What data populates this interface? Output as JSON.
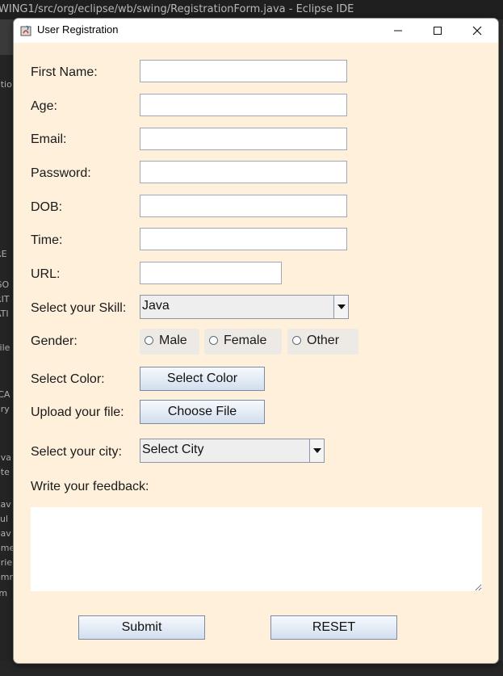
{
  "ide": {
    "title": "WING1/src/org/eclipse/wb/swing/RegistrationForm.java - Eclipse IDE",
    "left_fragments": [
      "atio",
      "RE",
      "GO",
      "RIT",
      "ATI",
      "File",
      "ICA",
      "ary",
      "ava",
      "ete",
      ".jav",
      "cul",
      ".jav",
      "ame",
      "arie",
      "omm",
      "rm"
    ]
  },
  "window": {
    "title": "User Registration",
    "controls": {
      "minimize": "minimize-icon",
      "maximize": "maximize-icon",
      "close": "close-icon"
    }
  },
  "form": {
    "labels": {
      "first_name": "First Name:",
      "age": "Age:",
      "email": "Email:",
      "password": "Password:",
      "dob": "DOB:",
      "time": "Time:",
      "url": "URL:",
      "skill": "Select your Skill:",
      "gender": "Gender:",
      "color": "Select Color:",
      "file": "Upload your file:",
      "city": "Select your city:",
      "feedback": "Write your feedback:"
    },
    "values": {
      "first_name": "",
      "age": "",
      "email": "",
      "password": "",
      "dob": "",
      "time": "",
      "url": "",
      "feedback": ""
    },
    "skill_selected": "Java",
    "city_selected": "Select City",
    "gender_options": [
      "Male",
      "Female",
      "Other"
    ],
    "select_color_button": "Select Color",
    "choose_file_button": "Choose File",
    "submit_button": "Submit",
    "reset_button": "RESET"
  },
  "colors": {
    "form_background": "#fff0db",
    "button_gradient_top": "#f6f9fd",
    "button_gradient_bottom": "#d2deee"
  }
}
